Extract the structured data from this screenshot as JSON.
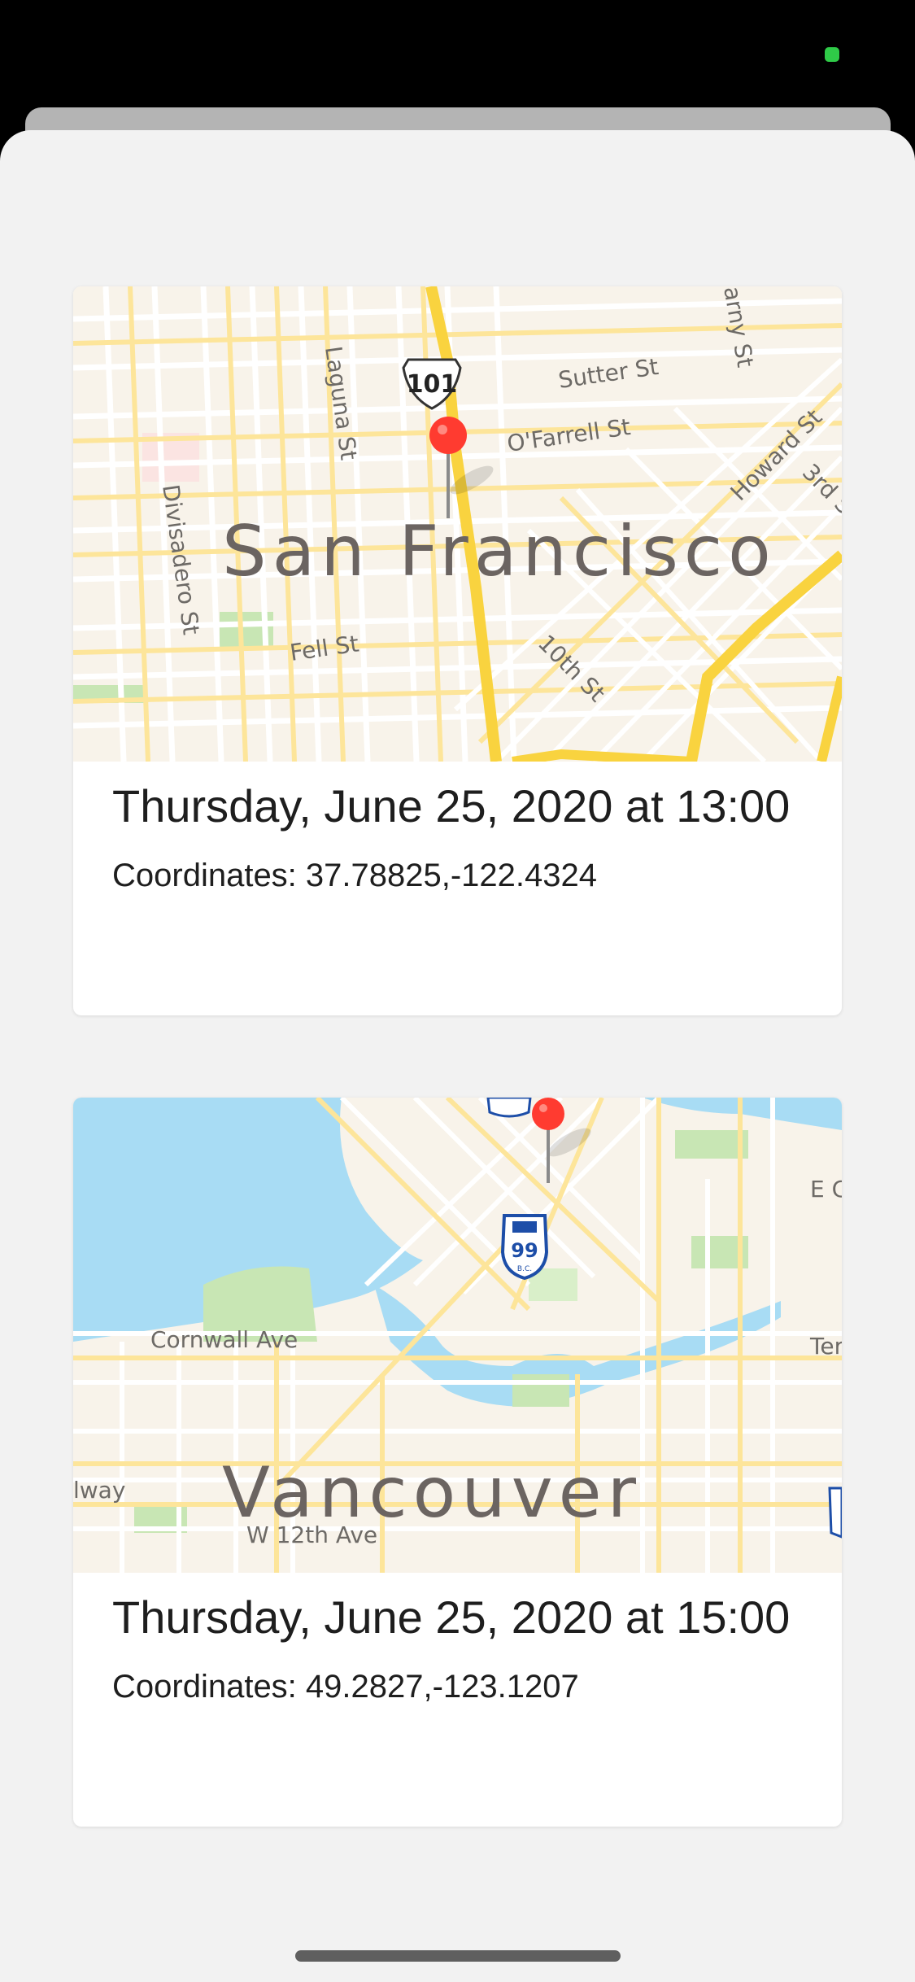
{
  "status_bar": {
    "indicator_color": "#2fcb48"
  },
  "cards": [
    {
      "map": {
        "city": "San Francisco",
        "streets": [
          "Sutter St",
          "O'Farrell St",
          "Laguna St",
          "Divisadero St",
          "Fell St",
          "10th St",
          "Howard St",
          "3rd S",
          "arny St"
        ],
        "highway_shield": "101",
        "pin_color": "#ff3b30"
      },
      "title": "Thursday, June 25, 2020 at 13:00",
      "coordinates": "Coordinates: 37.78825,-122.4324"
    },
    {
      "map": {
        "city": "Vancouver",
        "streets": [
          "Cornwall Ave",
          "W 12th Ave",
          "lway",
          "E C",
          "Ter"
        ],
        "highway_shield": "99",
        "shield_sub": "B.C.",
        "water_color": "#a8dcf4",
        "pin_color": "#ff3b30"
      },
      "title": "Thursday, June 25, 2020 at 15:00",
      "coordinates": "Coordinates: 49.2827,-123.1207"
    }
  ]
}
